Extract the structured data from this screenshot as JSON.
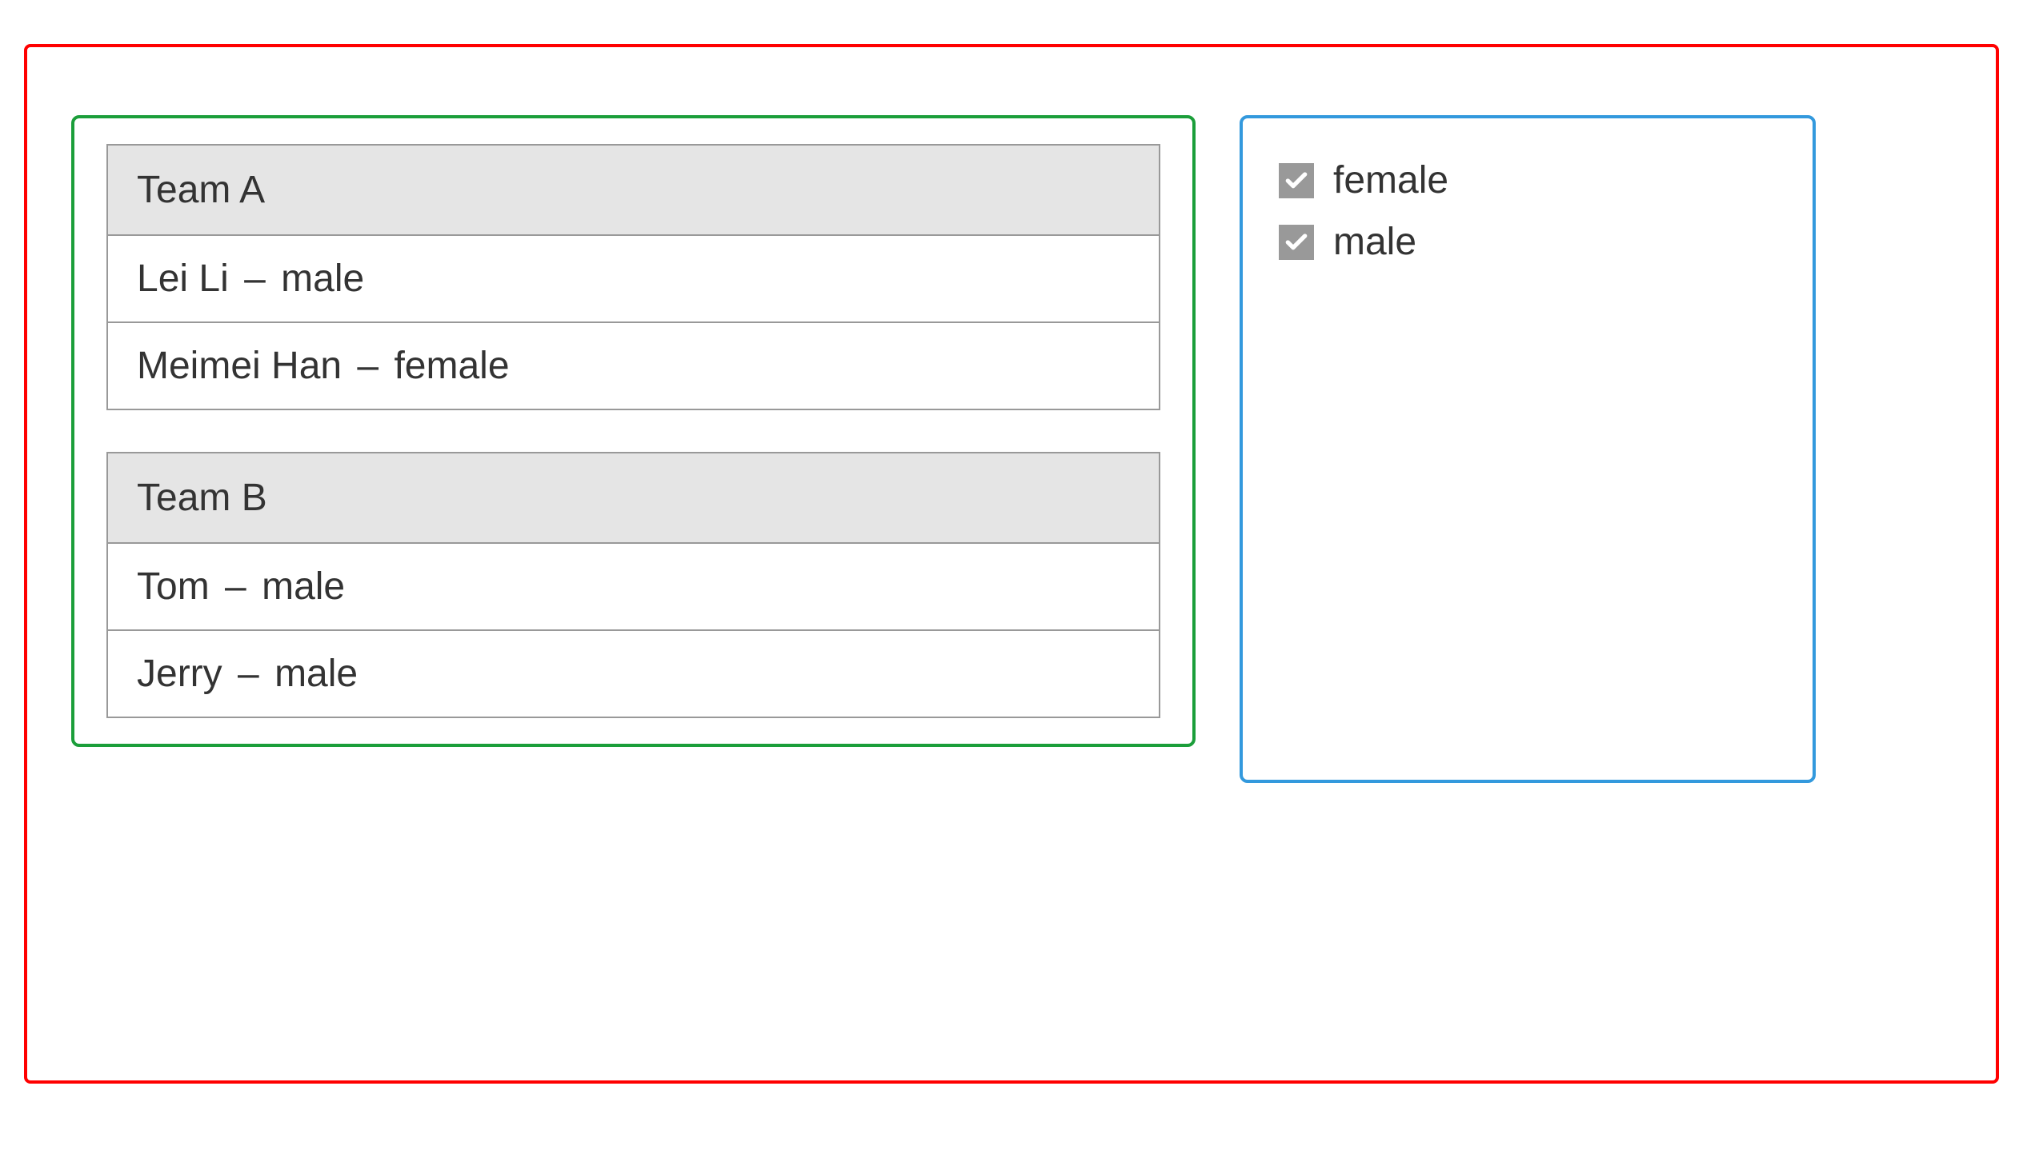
{
  "separator": "–",
  "teams": [
    {
      "name": "Team A",
      "members": [
        {
          "name": "Lei Li",
          "gender": "male"
        },
        {
          "name": "Meimei Han",
          "gender": "female"
        }
      ]
    },
    {
      "name": "Team B",
      "members": [
        {
          "name": "Tom",
          "gender": "male"
        },
        {
          "name": "Jerry",
          "gender": "male"
        }
      ]
    }
  ],
  "filters": [
    {
      "label": "female",
      "checked": true
    },
    {
      "label": "male",
      "checked": true
    }
  ]
}
